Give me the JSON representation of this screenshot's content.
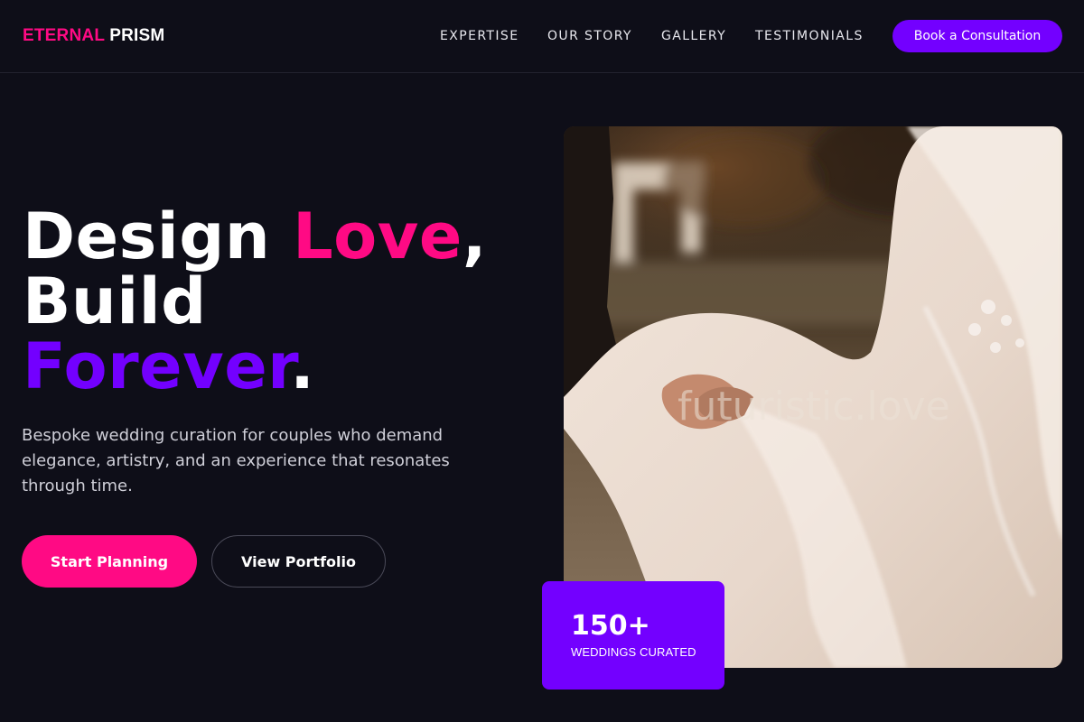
{
  "brand": {
    "name_part1": "ETERNAL",
    "name_part2": "PRISM"
  },
  "nav": {
    "links": [
      {
        "label": "EXPERTISE"
      },
      {
        "label": "OUR STORY"
      },
      {
        "label": "GALLERY"
      },
      {
        "label": "TESTIMONIALS"
      }
    ],
    "cta_label": "Book a Consultation"
  },
  "hero": {
    "headline": {
      "word1": "Design",
      "word2": "Love",
      "comma": ",",
      "word3": "Build",
      "word4": "Forever",
      "period": "."
    },
    "subtitle": "Bespoke wedding curation for couples who demand elegance, artistry, and an experience that resonates through time.",
    "primary_button": "Start Planning",
    "secondary_button": "View Portfolio",
    "image_watermark": "futuristic.love"
  },
  "stat": {
    "number": "150+",
    "label": "WEDDINGS CURATED"
  },
  "colors": {
    "background": "#0e0e18",
    "accent_pink": "#ff0a84",
    "accent_purple": "#7300ff"
  }
}
